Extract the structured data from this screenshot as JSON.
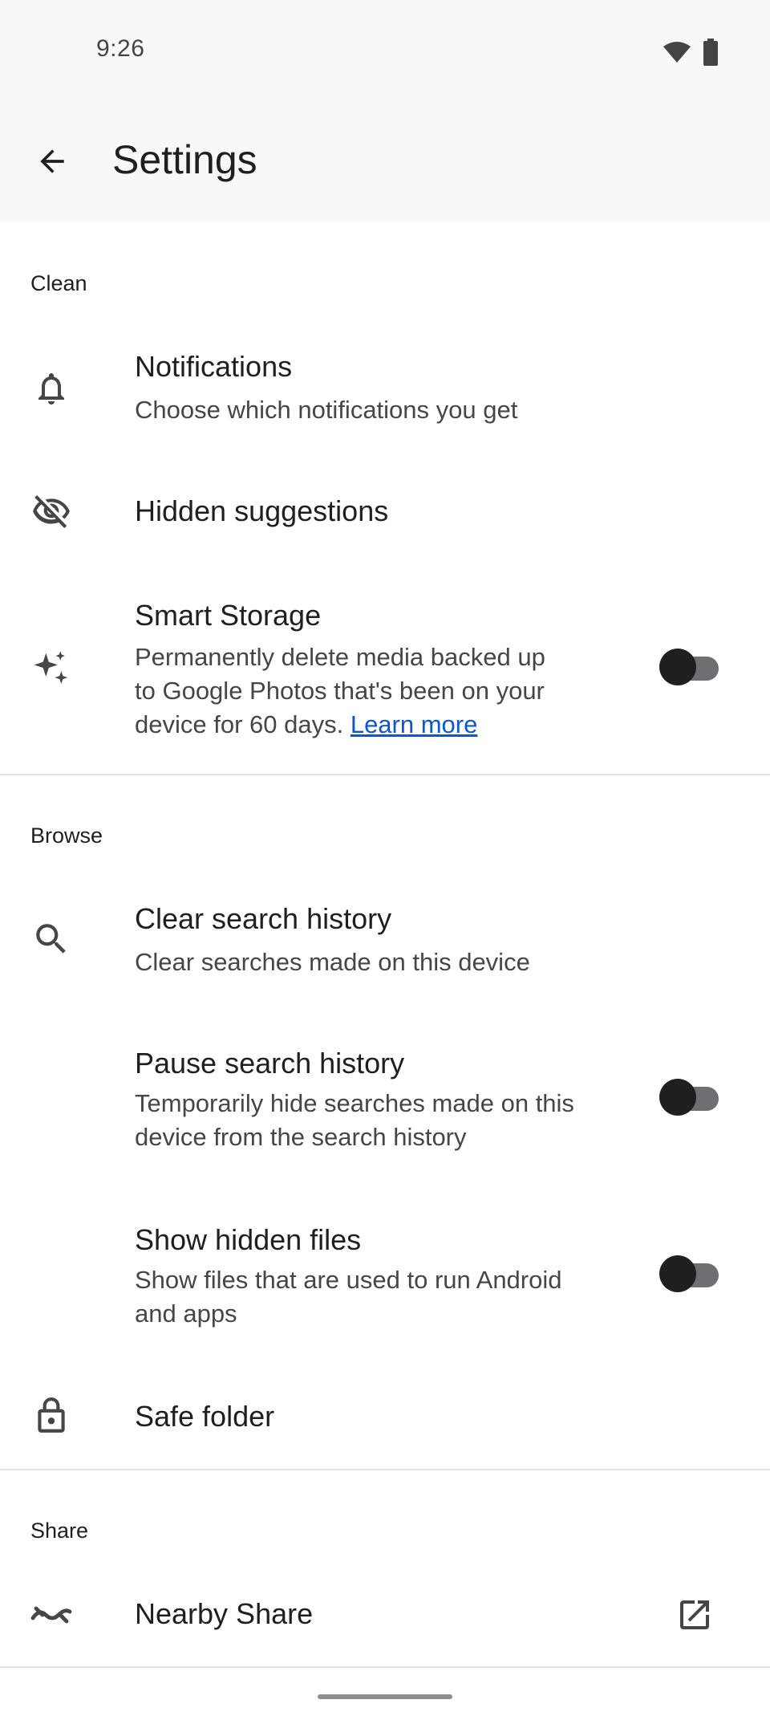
{
  "status_bar": {
    "time": "9:26"
  },
  "app_bar": {
    "title": "Settings"
  },
  "sections": {
    "clean": {
      "header": "Clean",
      "notifications": {
        "title": "Notifications",
        "subtitle": "Choose which notifications you get",
        "icon": "bell-icon"
      },
      "hidden_suggestions": {
        "title": "Hidden suggestions",
        "icon": "eye-off-icon"
      },
      "smart_storage": {
        "title": "Smart Storage",
        "subtitle_lines": [
          "Permanently delete media backed up",
          "to Google Photos that's been on your",
          "device for 60 days."
        ],
        "link": "Learn more",
        "icon": "sparkle-icon",
        "toggle_on": false
      }
    },
    "browse": {
      "header": "Browse",
      "clear_search": {
        "title": "Clear search history",
        "subtitle": "Clear searches made on this device",
        "icon": "search-icon"
      },
      "pause_search": {
        "title": "Pause search history",
        "subtitle_lines": [
          "Temporarily hide searches made on this",
          "device from the search history"
        ],
        "toggle_on": false
      },
      "hidden_files": {
        "title": "Show hidden files",
        "subtitle_lines": [
          "Show files that are used to run Android",
          "and apps"
        ],
        "toggle_on": false
      },
      "safe_folder": {
        "title": "Safe folder",
        "icon": "lock-icon"
      }
    },
    "share": {
      "header": "Share",
      "nearby_share": {
        "title": "Nearby Share",
        "icon": "nearby-share-icon",
        "trailing_icon": "open-external-icon"
      }
    }
  },
  "colors": {
    "link": "#0b57d0",
    "toggle_track": "#6f6f73",
    "toggle_thumb": "#1f1f1f"
  }
}
